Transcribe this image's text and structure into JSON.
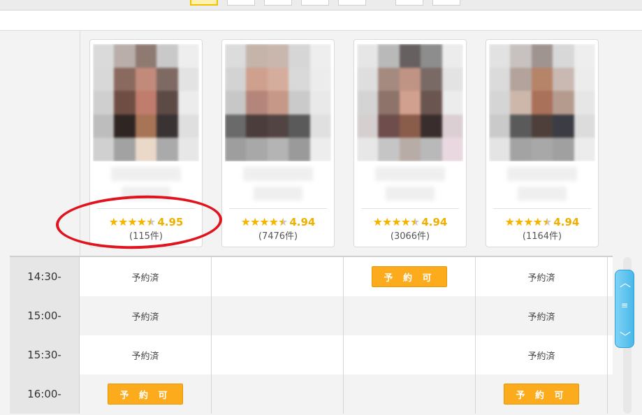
{
  "colors": {
    "accent_orange": "#fbab1b",
    "star_yellow": "#f5b400",
    "annotation_red": "#e0141f",
    "scroll_blue": "#4ab8ea"
  },
  "cards": [
    {
      "rating": "4.95",
      "count": "(115件)"
    },
    {
      "rating": "4.94",
      "count": "(7476件)"
    },
    {
      "rating": "4.94",
      "count": "(3066件)"
    },
    {
      "rating": "4.94",
      "count": "(1164件)"
    }
  ],
  "schedule": {
    "booked_label": "予約済",
    "available_label": "予 約 可",
    "rows": [
      {
        "time": "14:30-",
        "slots": [
          "booked",
          "",
          "available",
          "booked"
        ]
      },
      {
        "time": "15:00-",
        "slots": [
          "booked",
          "",
          "",
          "booked"
        ]
      },
      {
        "time": "15:30-",
        "slots": [
          "booked",
          "",
          "",
          "booked"
        ]
      },
      {
        "time": "16:00-",
        "slots": [
          "available",
          "",
          "",
          "available"
        ]
      }
    ]
  },
  "icons": {
    "star": "star-icon",
    "scroll_up": "chevron-up-icon",
    "scroll_down": "chevron-down-icon"
  }
}
